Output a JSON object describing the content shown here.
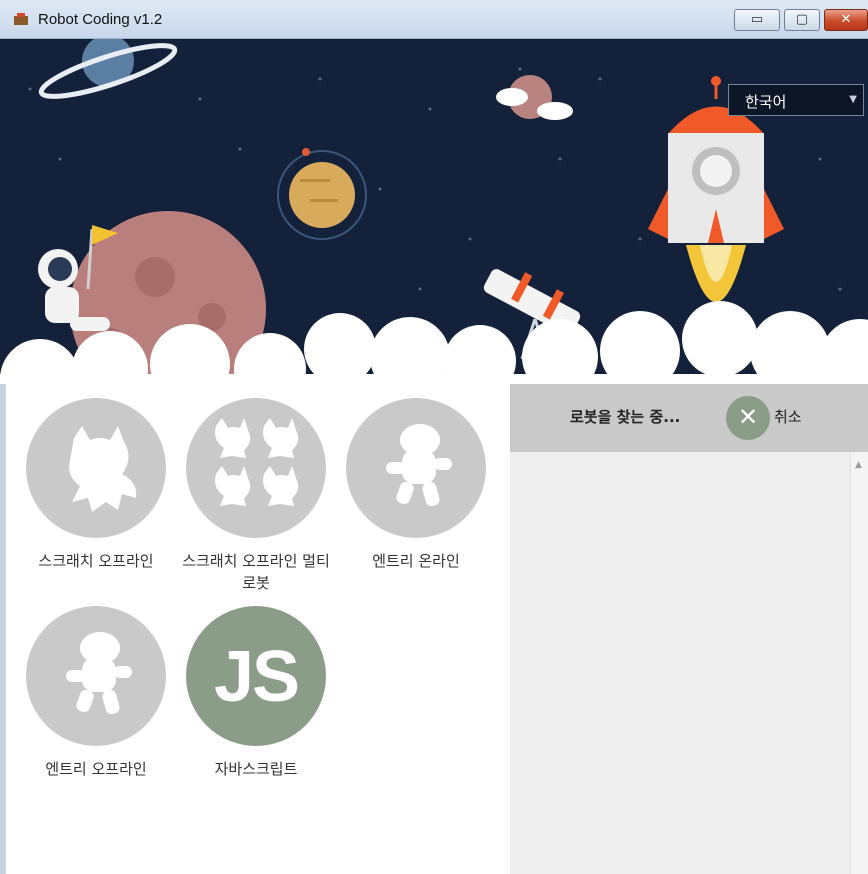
{
  "window": {
    "title": "Robot Coding v1.2",
    "controls": {
      "minimize": "▭",
      "maximize": "▢",
      "close": "✕"
    }
  },
  "language_select": {
    "value": "한국어",
    "caret": "▼"
  },
  "tiles": [
    {
      "label": "스크래치 오프라인",
      "icon": "scratch-cat-icon"
    },
    {
      "label": "스크래치 오프라인 멀티 로봇",
      "icon": "scratch-multi-cat-icon"
    },
    {
      "label": "엔트리 온라인",
      "icon": "entry-bot-icon"
    },
    {
      "label": "엔트리 오프라인",
      "icon": "entry-bot-icon"
    },
    {
      "label": "자바스크립트",
      "icon": "javascript-icon",
      "icon_text": "JS"
    }
  ],
  "robot_panel": {
    "status_text": "로봇을 찾는 중...",
    "cancel_icon": "✕",
    "cancel_label": "취소",
    "scroll_arrow": "▲"
  },
  "colors": {
    "banner_bg": "#13213a",
    "tile_gray": "#c9c9c9",
    "accent_green": "#8b9d88",
    "rocket_orange": "#f05a28"
  }
}
